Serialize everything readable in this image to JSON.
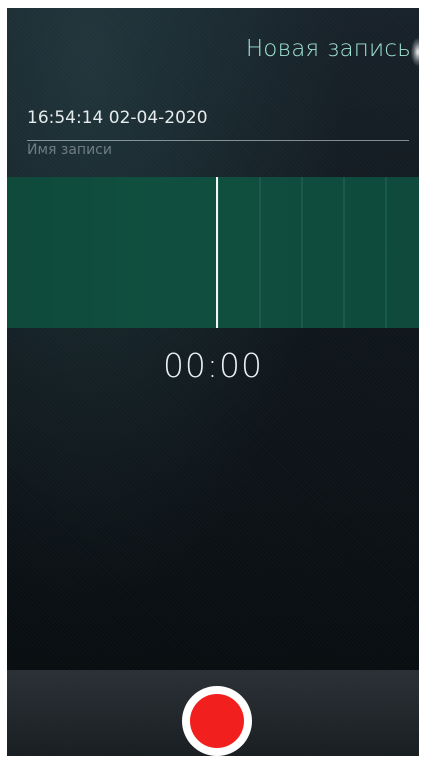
{
  "header": {
    "title": "Новая запись"
  },
  "recording": {
    "name_value": "16:54:14 02-04-2020",
    "name_label": "Имя записи",
    "timer": "00:00"
  },
  "controls": {
    "record_icon": "record-icon"
  },
  "colors": {
    "accent": "#9fe3d4",
    "waveform_bg": "#104f3f",
    "record": "#f21f1f"
  }
}
